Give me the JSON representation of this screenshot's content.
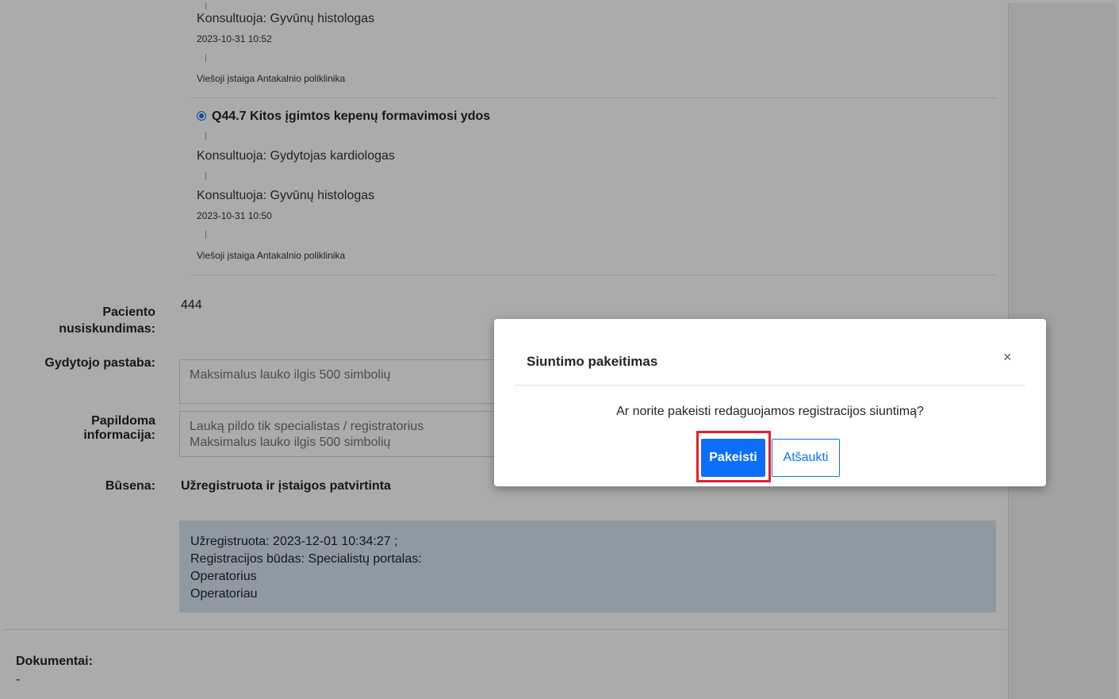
{
  "history_top": {
    "consult_line": "Konsultuoja: Gyvūnų histologas",
    "timestamp": "2023-10-31 10:52",
    "institution": "Viešoji įstaiga Antakalnio poliklinika"
  },
  "diagnosis": {
    "title": "Q44.7 Kitos įgimtos kepenų formavimosi ydos",
    "consult_1": "Konsultuoja: Gydytojas kardiologas",
    "consult_2": "Konsultuoja: Gyvūnų histologas",
    "timestamp": "2023-10-31 10:50",
    "institution": "Viešoji įstaiga Antakalnio poliklinika"
  },
  "form": {
    "complaint_label_line1": "Paciento",
    "complaint_label_line2": "nusiskundimas:",
    "complaint_value": "444",
    "doctor_note_label": "Gydytojo pastaba:",
    "doctor_note_placeholder": "Maksimalus lauko ilgis 500 simbolių",
    "additional_info_label": "Papildoma informacija:",
    "additional_info_placeholder": "Lauką pildo tik specialistas / registratorius\nMaksimalus lauko ilgis 500 simbolių",
    "status_label": "Būsena:",
    "status_value": "Užregistruota ir įstaigos patvirtinta"
  },
  "info_box": {
    "line1": "Užregistruota: 2023-12-01 10:34:27 ;",
    "line2": "Registracijos būdas: Specialistų portalas:",
    "line3": "Operatorius",
    "line4": "Operatoriau"
  },
  "documents": {
    "label": "Dokumentai:",
    "value": "-"
  },
  "modal": {
    "title": "Siuntimo pakeitimas",
    "close_symbol": "×",
    "message": "Ar norite pakeisti redaguojamos registracijos siuntimą?",
    "confirm_label": "Pakeisti",
    "cancel_label": "Atšaukti"
  }
}
